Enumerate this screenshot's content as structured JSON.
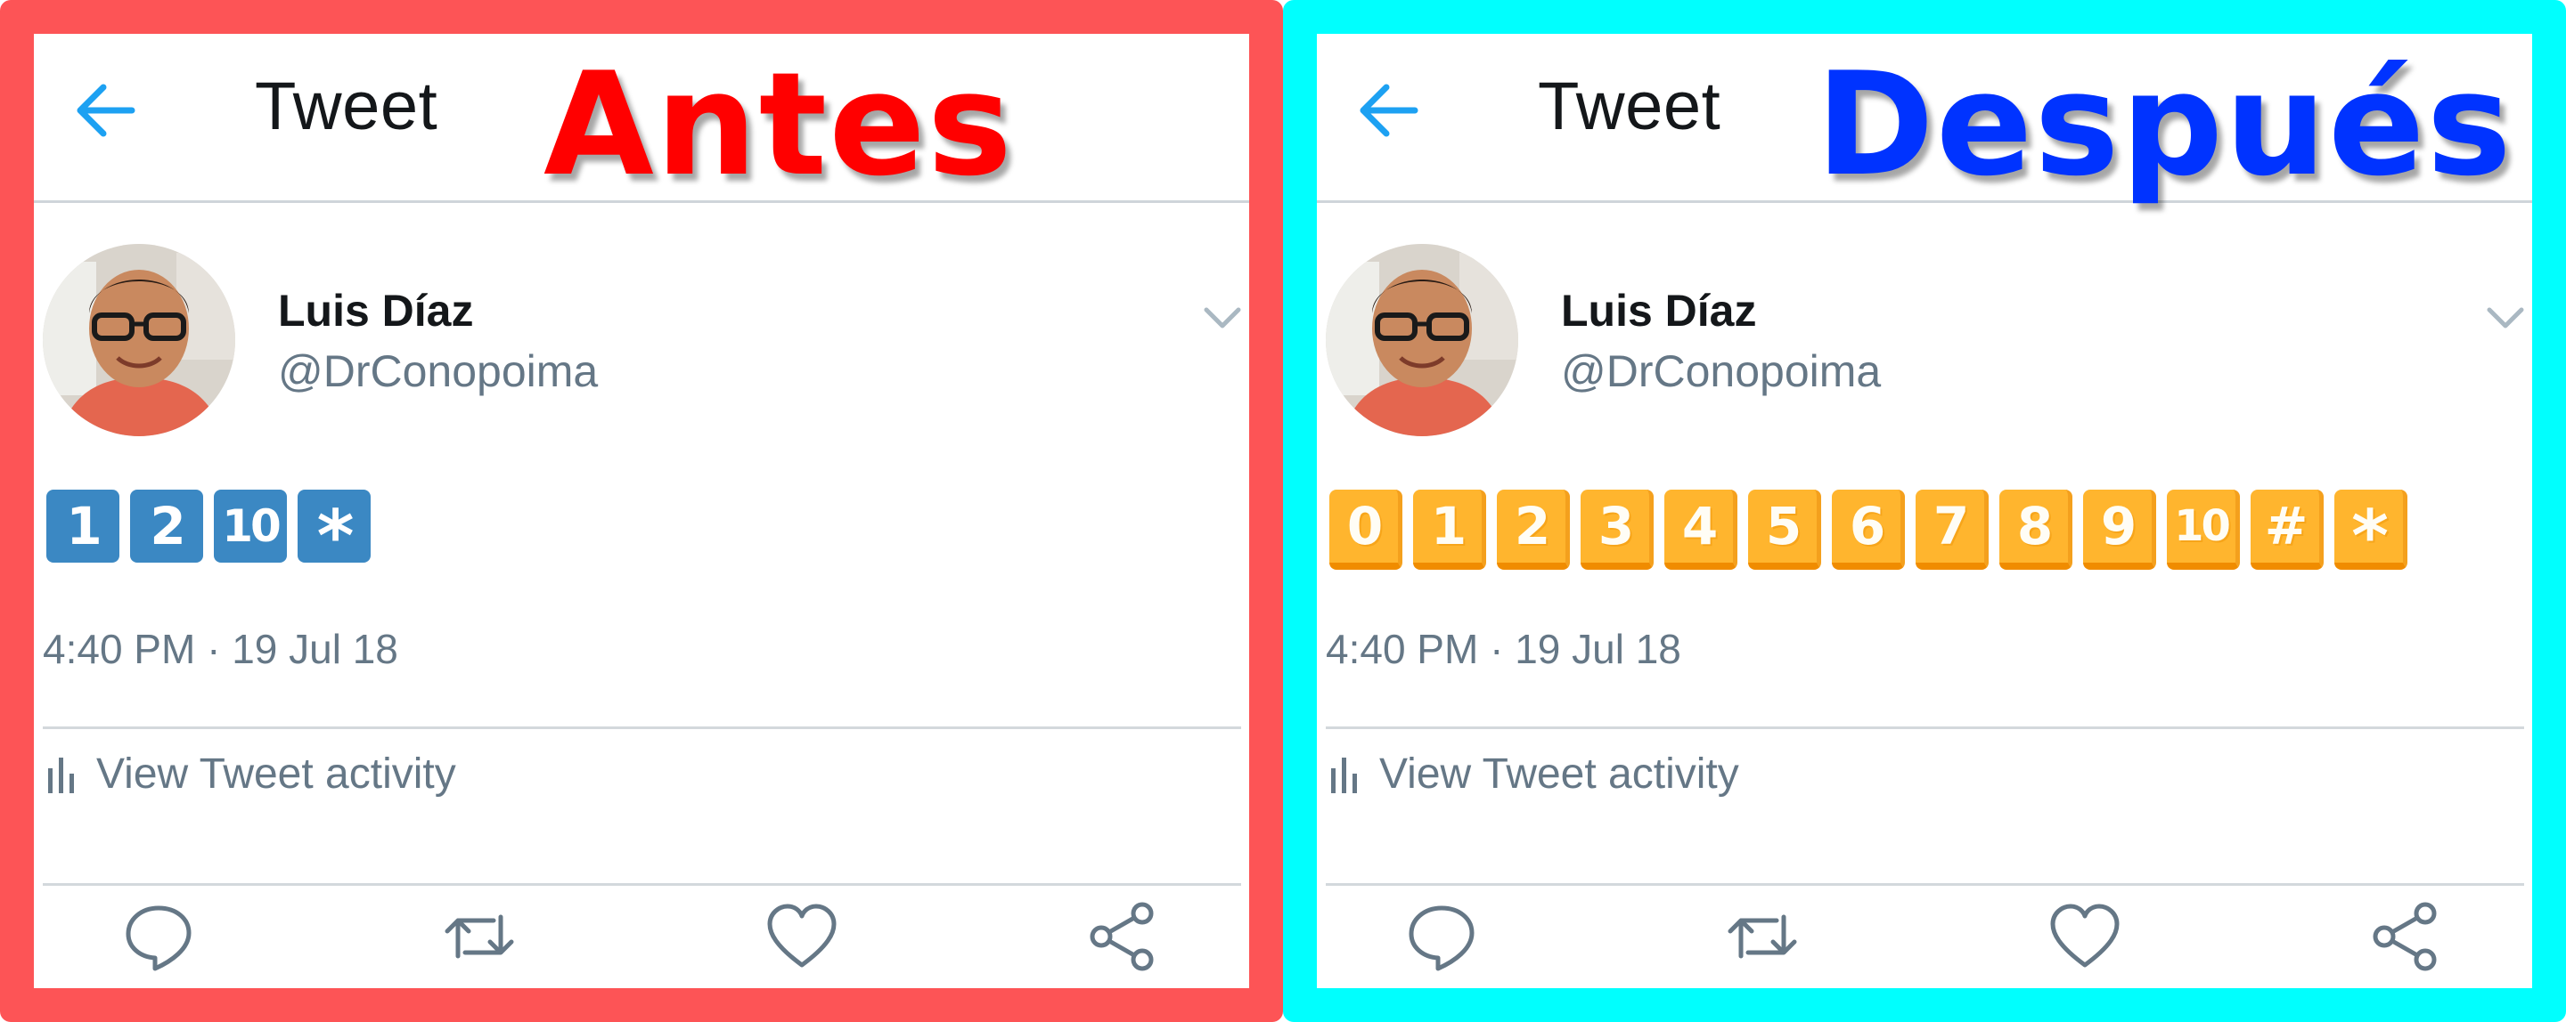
{
  "panels": [
    {
      "id": "before",
      "header": {
        "title": "Tweet"
      },
      "overlay_label": "Antes",
      "user": {
        "name": "Luis Díaz",
        "handle": "@DrConopoima"
      },
      "emojis": [
        "1",
        "2",
        "10",
        "*"
      ],
      "timestamp": "4:40 PM · 19 Jul 18",
      "activity_label": "View Tweet activity"
    },
    {
      "id": "after",
      "header": {
        "title": "Tweet"
      },
      "overlay_label": "Después",
      "user": {
        "name": "Luis Díaz",
        "handle": "@DrConopoima"
      },
      "emojis": [
        "0",
        "1",
        "2",
        "3",
        "4",
        "5",
        "6",
        "7",
        "8",
        "9",
        "10",
        "#",
        "*"
      ],
      "timestamp": "4:40 PM · 19 Jul 18",
      "activity_label": "View Tweet activity"
    }
  ],
  "icons": {
    "back": "arrow-left-icon",
    "chevron": "chevron-down-icon",
    "activity": "bar-chart-icon",
    "reply": "reply-icon",
    "retweet": "retweet-icon",
    "like": "heart-icon",
    "share": "share-icon"
  },
  "colors": {
    "before_border": "#fd5456",
    "after_border": "#00fffe",
    "before_label": "#ff0000",
    "after_label": "#0033ff",
    "twitter_blue": "#1da1f2",
    "keycap_blue": "#3b88c3",
    "keycap_yellow": "#ffb52e"
  }
}
